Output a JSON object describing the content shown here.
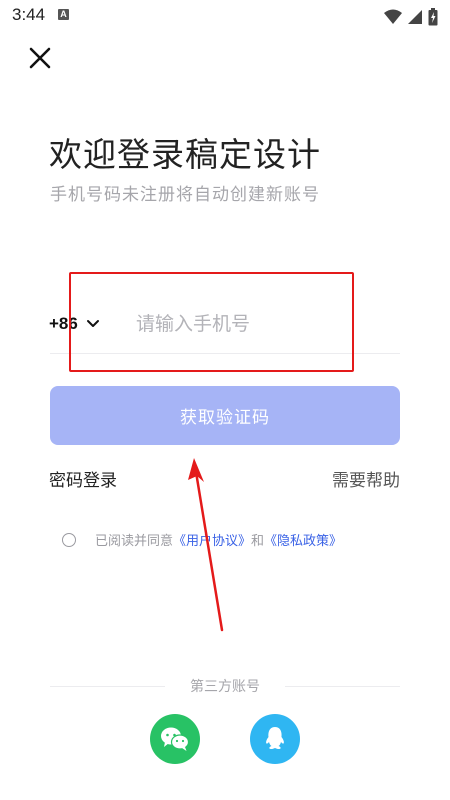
{
  "status_bar": {
    "time": "3:44",
    "notification_icon": "A",
    "icons": [
      "wifi-icon",
      "signal-icon",
      "battery-icon"
    ]
  },
  "header": {
    "close_icon": "close-icon"
  },
  "main": {
    "title": "欢迎登录稿定设计",
    "subtitle": "手机号码未注册将自动创建新账号",
    "country_code": "+86",
    "phone_placeholder": "请输入手机号",
    "phone_value": "",
    "code_button_label": "获取验证码",
    "password_login_label": "密码登录",
    "help_label": "需要帮助"
  },
  "agreement": {
    "prefix": "已阅读并同意",
    "user_agreement": "《用户协议》",
    "and": "和",
    "privacy_policy": "《隐私政策》",
    "checked": false
  },
  "third_party": {
    "label": "第三方账号",
    "providers": [
      "wechat-icon",
      "qq-icon"
    ]
  },
  "colors": {
    "primary_disabled": "#a6b4f6",
    "link": "#3a62e6",
    "annotation_red": "#e41a1a",
    "wechat_green": "#28c265",
    "qq_blue": "#2fb6f2"
  }
}
